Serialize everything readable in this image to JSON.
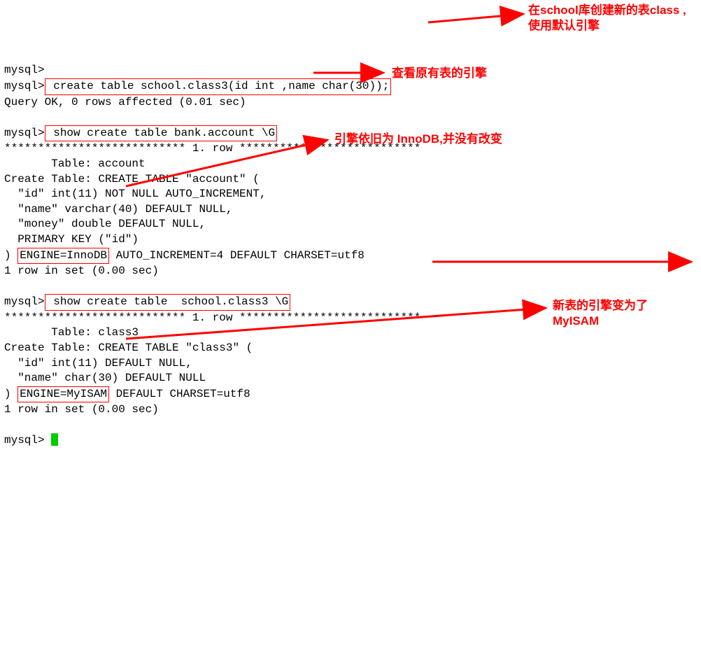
{
  "lines": {
    "p1": "mysql>",
    "p2": "mysql>",
    "cmd1": " create table school.class3(id int ,name char(30));",
    "l3": "Query OK, 0 rows affected (0.01 sec)",
    "blank1": "",
    "p3": "mysql>",
    "cmd2": " show create table bank.account \\G",
    "l5": "*************************** 1. row ***************************",
    "l6": "       Table: account",
    "l7": "Create Table: CREATE TABLE \"account\" (",
    "l8": "  \"id\" int(11) NOT NULL AUTO_INCREMENT,",
    "l9": "  \"name\" varchar(40) DEFAULT NULL,",
    "l10": "  \"money\" double DEFAULT NULL,",
    "l11": "  PRIMARY KEY (\"id\")",
    "l12a": ") ",
    "engine1": "ENGINE=InnoDB",
    "l12b": " AUTO_INCREMENT=4 DEFAULT CHARSET=utf8",
    "l13": "1 row in set (0.00 sec)",
    "blank2": "",
    "p4": "mysql>",
    "cmd3": " show create table  school.class3 \\G",
    "l15": "*************************** 1. row ***************************",
    "l16": "       Table: class3",
    "l17": "Create Table: CREATE TABLE \"class3\" (",
    "l18": "  \"id\" int(11) DEFAULT NULL,",
    "l19": "  \"name\" char(30) DEFAULT NULL",
    "l20a": ") ",
    "engine2": "ENGINE=MyISAM",
    "l20b": " DEFAULT CHARSET=utf8",
    "l21": "1 row in set (0.00 sec)",
    "blank3": "",
    "p5": "mysql> "
  },
  "annotations": {
    "a1": "在school库创建新的表class ,使用默认引擎",
    "a2": "查看原有表的引擎",
    "a3": "引擎依旧为 InnoDB,并没有改变",
    "a4": "新表的引擎变为了MyISAM"
  }
}
